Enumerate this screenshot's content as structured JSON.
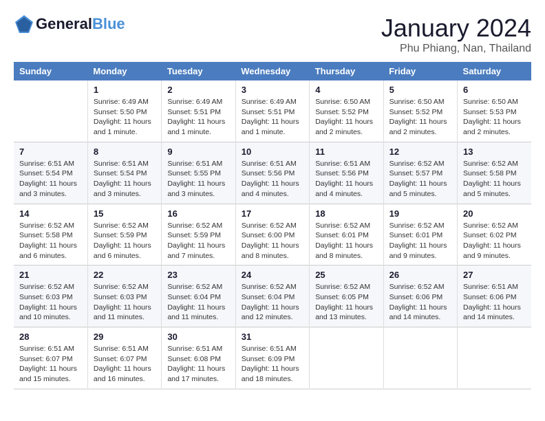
{
  "header": {
    "logo_line1": "General",
    "logo_line2": "Blue",
    "month_title": "January 2024",
    "location": "Phu Phiang, Nan, Thailand"
  },
  "weekdays": [
    "Sunday",
    "Monday",
    "Tuesday",
    "Wednesday",
    "Thursday",
    "Friday",
    "Saturday"
  ],
  "weeks": [
    [
      {
        "day": "",
        "info": ""
      },
      {
        "day": "1",
        "info": "Sunrise: 6:49 AM\nSunset: 5:50 PM\nDaylight: 11 hours\nand 1 minute."
      },
      {
        "day": "2",
        "info": "Sunrise: 6:49 AM\nSunset: 5:51 PM\nDaylight: 11 hours\nand 1 minute."
      },
      {
        "day": "3",
        "info": "Sunrise: 6:49 AM\nSunset: 5:51 PM\nDaylight: 11 hours\nand 1 minute."
      },
      {
        "day": "4",
        "info": "Sunrise: 6:50 AM\nSunset: 5:52 PM\nDaylight: 11 hours\nand 2 minutes."
      },
      {
        "day": "5",
        "info": "Sunrise: 6:50 AM\nSunset: 5:52 PM\nDaylight: 11 hours\nand 2 minutes."
      },
      {
        "day": "6",
        "info": "Sunrise: 6:50 AM\nSunset: 5:53 PM\nDaylight: 11 hours\nand 2 minutes."
      }
    ],
    [
      {
        "day": "7",
        "info": "Sunrise: 6:51 AM\nSunset: 5:54 PM\nDaylight: 11 hours\nand 3 minutes."
      },
      {
        "day": "8",
        "info": "Sunrise: 6:51 AM\nSunset: 5:54 PM\nDaylight: 11 hours\nand 3 minutes."
      },
      {
        "day": "9",
        "info": "Sunrise: 6:51 AM\nSunset: 5:55 PM\nDaylight: 11 hours\nand 3 minutes."
      },
      {
        "day": "10",
        "info": "Sunrise: 6:51 AM\nSunset: 5:56 PM\nDaylight: 11 hours\nand 4 minutes."
      },
      {
        "day": "11",
        "info": "Sunrise: 6:51 AM\nSunset: 5:56 PM\nDaylight: 11 hours\nand 4 minutes."
      },
      {
        "day": "12",
        "info": "Sunrise: 6:52 AM\nSunset: 5:57 PM\nDaylight: 11 hours\nand 5 minutes."
      },
      {
        "day": "13",
        "info": "Sunrise: 6:52 AM\nSunset: 5:58 PM\nDaylight: 11 hours\nand 5 minutes."
      }
    ],
    [
      {
        "day": "14",
        "info": "Sunrise: 6:52 AM\nSunset: 5:58 PM\nDaylight: 11 hours\nand 6 minutes."
      },
      {
        "day": "15",
        "info": "Sunrise: 6:52 AM\nSunset: 5:59 PM\nDaylight: 11 hours\nand 6 minutes."
      },
      {
        "day": "16",
        "info": "Sunrise: 6:52 AM\nSunset: 5:59 PM\nDaylight: 11 hours\nand 7 minutes."
      },
      {
        "day": "17",
        "info": "Sunrise: 6:52 AM\nSunset: 6:00 PM\nDaylight: 11 hours\nand 8 minutes."
      },
      {
        "day": "18",
        "info": "Sunrise: 6:52 AM\nSunset: 6:01 PM\nDaylight: 11 hours\nand 8 minutes."
      },
      {
        "day": "19",
        "info": "Sunrise: 6:52 AM\nSunset: 6:01 PM\nDaylight: 11 hours\nand 9 minutes."
      },
      {
        "day": "20",
        "info": "Sunrise: 6:52 AM\nSunset: 6:02 PM\nDaylight: 11 hours\nand 9 minutes."
      }
    ],
    [
      {
        "day": "21",
        "info": "Sunrise: 6:52 AM\nSunset: 6:03 PM\nDaylight: 11 hours\nand 10 minutes."
      },
      {
        "day": "22",
        "info": "Sunrise: 6:52 AM\nSunset: 6:03 PM\nDaylight: 11 hours\nand 11 minutes."
      },
      {
        "day": "23",
        "info": "Sunrise: 6:52 AM\nSunset: 6:04 PM\nDaylight: 11 hours\nand 11 minutes."
      },
      {
        "day": "24",
        "info": "Sunrise: 6:52 AM\nSunset: 6:04 PM\nDaylight: 11 hours\nand 12 minutes."
      },
      {
        "day": "25",
        "info": "Sunrise: 6:52 AM\nSunset: 6:05 PM\nDaylight: 11 hours\nand 13 minutes."
      },
      {
        "day": "26",
        "info": "Sunrise: 6:52 AM\nSunset: 6:06 PM\nDaylight: 11 hours\nand 14 minutes."
      },
      {
        "day": "27",
        "info": "Sunrise: 6:51 AM\nSunset: 6:06 PM\nDaylight: 11 hours\nand 14 minutes."
      }
    ],
    [
      {
        "day": "28",
        "info": "Sunrise: 6:51 AM\nSunset: 6:07 PM\nDaylight: 11 hours\nand 15 minutes."
      },
      {
        "day": "29",
        "info": "Sunrise: 6:51 AM\nSunset: 6:07 PM\nDaylight: 11 hours\nand 16 minutes."
      },
      {
        "day": "30",
        "info": "Sunrise: 6:51 AM\nSunset: 6:08 PM\nDaylight: 11 hours\nand 17 minutes."
      },
      {
        "day": "31",
        "info": "Sunrise: 6:51 AM\nSunset: 6:09 PM\nDaylight: 11 hours\nand 18 minutes."
      },
      {
        "day": "",
        "info": ""
      },
      {
        "day": "",
        "info": ""
      },
      {
        "day": "",
        "info": ""
      }
    ]
  ]
}
